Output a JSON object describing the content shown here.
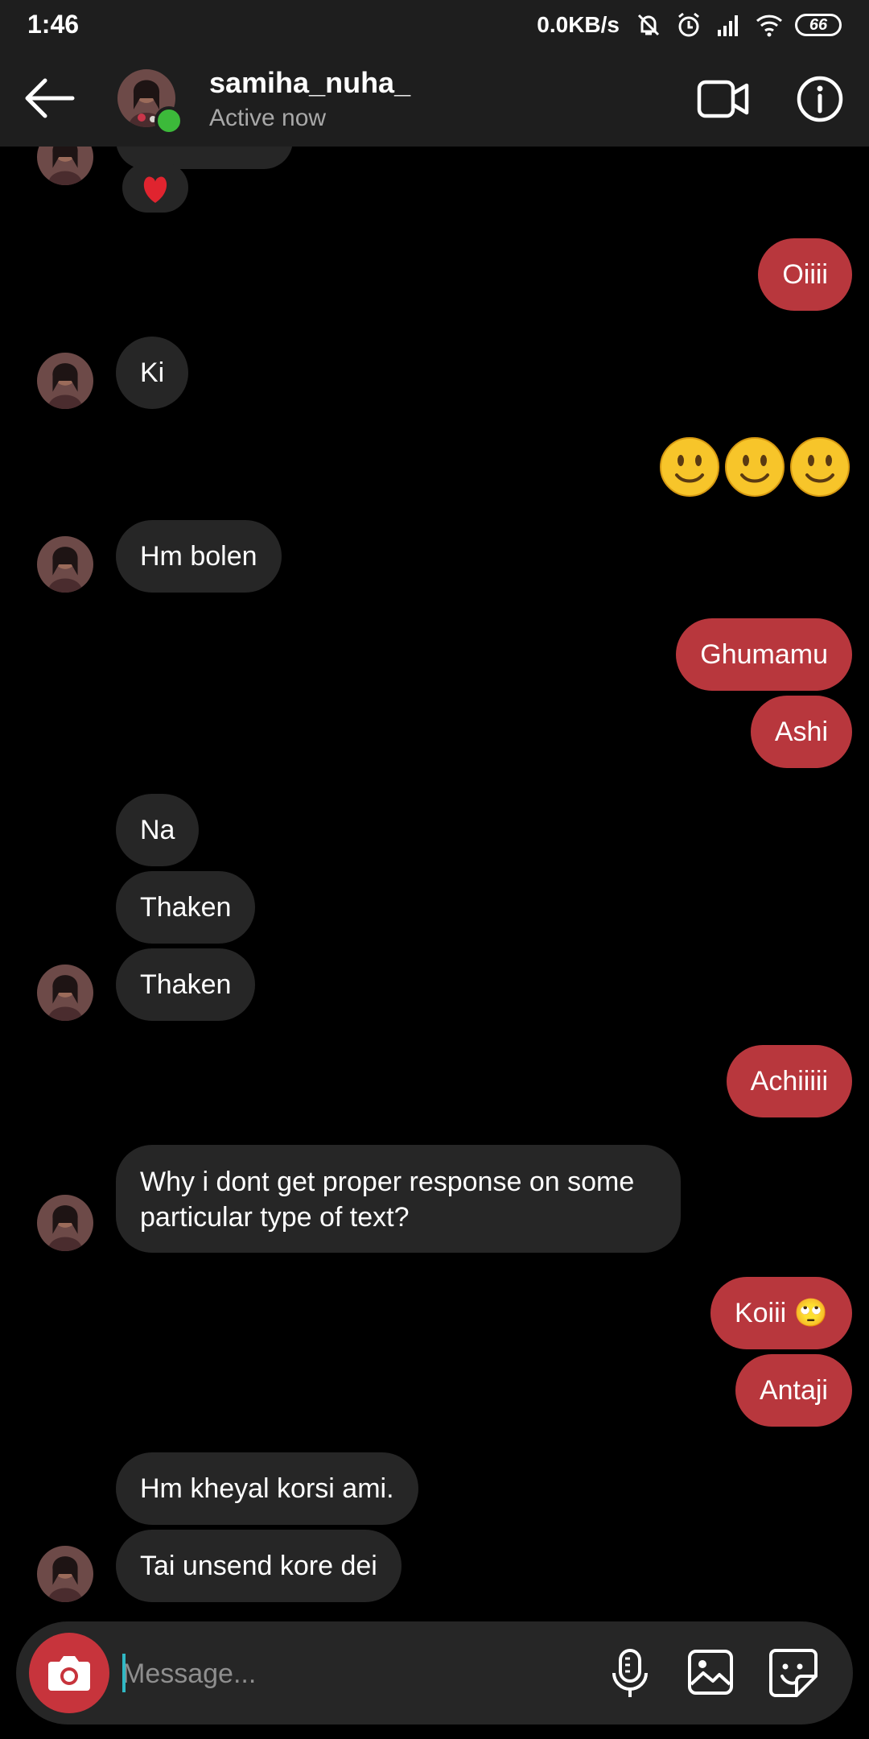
{
  "status_bar": {
    "time": "1:46",
    "speed": "0.0KB/s",
    "battery": "66"
  },
  "header": {
    "username": "samiha_nuha_",
    "status": "Active now"
  },
  "messages": [
    {
      "from": "them",
      "text": "❤️",
      "type": "reaction"
    },
    {
      "from": "me",
      "text": "Oiiii"
    },
    {
      "from": "them",
      "text": "Ki"
    },
    {
      "from": "me",
      "text": "🙂🙂🙂",
      "type": "emoji"
    },
    {
      "from": "them",
      "text": "Hm bolen"
    },
    {
      "from": "me",
      "text": "Ghumamu"
    },
    {
      "from": "me",
      "text": "Ashi"
    },
    {
      "from": "them",
      "text": "Na"
    },
    {
      "from": "them",
      "text": "Thaken"
    },
    {
      "from": "them",
      "text": "Thaken"
    },
    {
      "from": "me",
      "text": "Achiiiii"
    },
    {
      "from": "them",
      "text": "Why i dont get proper response on some particular type of text?"
    },
    {
      "from": "me",
      "text": "Koiii 🙄"
    },
    {
      "from": "me",
      "text": "Antaji"
    },
    {
      "from": "them",
      "text": "Hm kheyal korsi ami."
    },
    {
      "from": "them",
      "text": "Tai unsend kore dei"
    }
  ],
  "composer": {
    "placeholder": "Message..."
  },
  "colors": {
    "outgoing": "#b8373d",
    "incoming": "#262626",
    "online": "#3cb93a"
  }
}
